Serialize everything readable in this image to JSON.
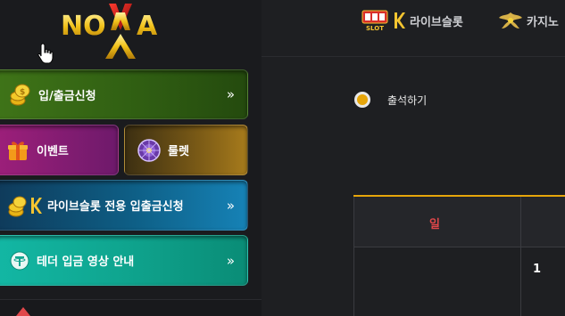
{
  "brand": {
    "logo_text": "NOVA",
    "logo_overlay": "X"
  },
  "sidebar": {
    "deposit_label": "입/출금신청",
    "event_label": "이벤트",
    "roulette_label": "룰렛",
    "live_slot_label": "라이브슬롯 전용 입출금신청",
    "tether_label": "테더 입금 영상 안내",
    "arrow": "»"
  },
  "topnav": {
    "live_slot": "라이브슬롯",
    "casino": "카지노",
    "slot_badge": "SLOT"
  },
  "attendance": {
    "label": "출석하기",
    "table": {
      "header_day": "일",
      "day_number": "1"
    }
  },
  "colors": {
    "accent": "#e6a50a",
    "sunday_red": "#e0474a"
  }
}
